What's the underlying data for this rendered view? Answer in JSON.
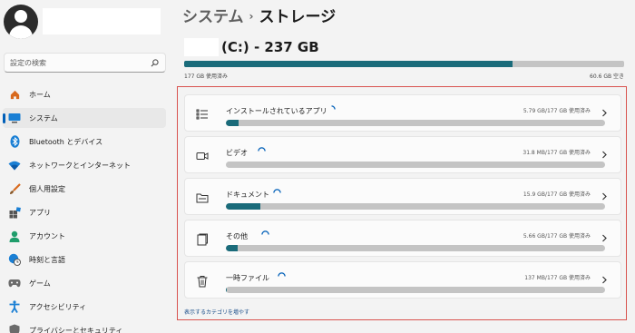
{
  "sidebar": {
    "search_placeholder": "設定の検索",
    "items": [
      {
        "label": "ホーム",
        "icon": "home-icon"
      },
      {
        "label": "システム",
        "icon": "system-icon",
        "active": true
      },
      {
        "label": "Bluetooth とデバイス",
        "icon": "bluetooth-icon"
      },
      {
        "label": "ネットワークとインターネット",
        "icon": "wifi-icon"
      },
      {
        "label": "個人用設定",
        "icon": "brush-icon"
      },
      {
        "label": "アプリ",
        "icon": "apps-icon"
      },
      {
        "label": "アカウント",
        "icon": "account-icon"
      },
      {
        "label": "時刻と言語",
        "icon": "globe-clock-icon"
      },
      {
        "label": "ゲーム",
        "icon": "game-controller-icon"
      },
      {
        "label": "アクセシビリティ",
        "icon": "accessibility-icon"
      },
      {
        "label": "プライバシーとセキュリティ",
        "icon": "shield-icon"
      }
    ]
  },
  "header": {
    "parent": "システム",
    "separator": "›",
    "current": "ストレージ"
  },
  "drive": {
    "title": "(C:) - 237 GB",
    "used_label": "177 GB 使用済み",
    "free_label": "60.6 GB 空き",
    "used_fraction": 0.747
  },
  "categories": [
    {
      "label": "インストールされているアプリ",
      "size": "5.79 GB/177 GB 使用済み",
      "icon": "apps-list-icon",
      "fill_fraction": 0.033
    },
    {
      "label": "ビデオ",
      "size": "31.8 MB/177 GB 使用済み",
      "icon": "video-camera-icon",
      "fill_fraction": 0.0
    },
    {
      "label": "ドキュメント",
      "size": "15.9 GB/177 GB 使用済み",
      "icon": "folder-icon",
      "fill_fraction": 0.09
    },
    {
      "label": "その他",
      "size": "5.66 GB/177 GB 使用済み",
      "icon": "other-files-icon",
      "fill_fraction": 0.032
    },
    {
      "label": "一時ファイル",
      "size": "137 MB/177 GB 使用済み",
      "icon": "trash-icon",
      "fill_fraction": 0.0008
    }
  ],
  "more_link": "表示するカテゴリを増やす",
  "colors": {
    "accent": "#005fb8",
    "bar_fill": "#1a6b7a",
    "bar_track": "#c4c4c4",
    "highlight_border": "#d9534f"
  }
}
